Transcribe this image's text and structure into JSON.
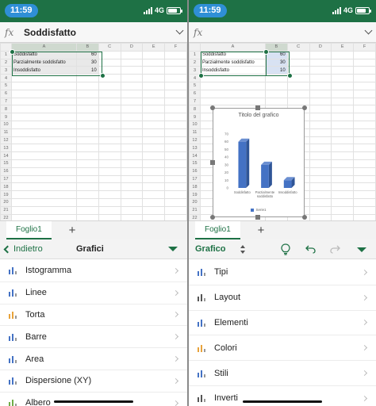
{
  "status": {
    "time": "11:59",
    "network": "4G"
  },
  "left": {
    "formula_value": "Soddisfatto",
    "columns": [
      "A",
      "B",
      "C",
      "D",
      "E",
      "F"
    ],
    "cells": [
      {
        "label": "Soddisfatto",
        "value": "60"
      },
      {
        "label": "Parzialmente soddisfatto",
        "value": "30"
      },
      {
        "label": "Insoddisfatto",
        "value": "10"
      }
    ],
    "sheet_tab": "Foglio1",
    "add_sheet": "+",
    "ribbon": {
      "back_label": "Indietro",
      "title": "Grafici"
    },
    "menu": [
      {
        "label": "Istogramma",
        "icon": "column-chart-icon"
      },
      {
        "label": "Linee",
        "icon": "line-chart-icon"
      },
      {
        "label": "Torta",
        "icon": "pie-chart-icon"
      },
      {
        "label": "Barre",
        "icon": "bar-chart-icon"
      },
      {
        "label": "Area",
        "icon": "area-chart-icon"
      },
      {
        "label": "Dispersione (XY)",
        "icon": "scatter-chart-icon"
      },
      {
        "label": "Albero",
        "icon": "tree-chart-icon"
      }
    ]
  },
  "right": {
    "formula_value": "",
    "sheet_tab": "Foglio1",
    "add_sheet": "+",
    "ribbon": {
      "title": "Grafico"
    },
    "menu": [
      {
        "label": "Tipi",
        "icon": "types-icon"
      },
      {
        "label": "Layout",
        "icon": "layout-icon"
      },
      {
        "label": "Elementi",
        "icon": "elements-icon"
      },
      {
        "label": "Colori",
        "icon": "colors-icon"
      },
      {
        "label": "Stili",
        "icon": "styles-icon"
      },
      {
        "label": "Inverti",
        "icon": "swap-icon"
      }
    ]
  },
  "chart_data": {
    "type": "bar",
    "title": "Titolo del grafico",
    "categories": [
      "Soddisfatto",
      "Parzialmente soddisfatto",
      "Insoddisfatto"
    ],
    "series": [
      {
        "name": "Serie1",
        "values": [
          60,
          30,
          10
        ]
      }
    ],
    "ylim": [
      0,
      70
    ],
    "yticks": [
      0,
      10,
      20,
      30,
      40,
      50,
      60,
      70
    ],
    "grid": false,
    "legend": "bottom",
    "bar_color": "#4472c4"
  },
  "colors": {
    "brand": "#1e7145",
    "status_pill": "#2f8fd6"
  }
}
